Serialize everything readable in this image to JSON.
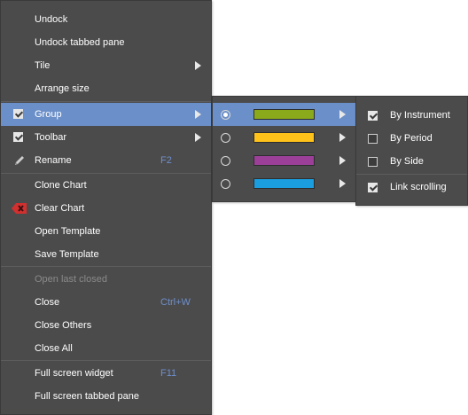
{
  "main_menu": {
    "items": [
      {
        "label": "Undock"
      },
      {
        "label": "Undock tabbed pane"
      },
      {
        "label": "Tile"
      },
      {
        "label": "Arrange size"
      },
      {
        "label": "Group"
      },
      {
        "label": "Toolbar"
      },
      {
        "label": "Rename",
        "shortcut": "F2"
      },
      {
        "label": "Clone Chart"
      },
      {
        "label": "Clear Chart"
      },
      {
        "label": "Open Template"
      },
      {
        "label": "Save Template"
      },
      {
        "label": "Open last closed"
      },
      {
        "label": "Close",
        "shortcut": "Ctrl+W"
      },
      {
        "label": "Close Others"
      },
      {
        "label": "Close All"
      },
      {
        "label": "Full screen widget",
        "shortcut": "F11"
      },
      {
        "label": "Full screen tabbed pane"
      }
    ]
  },
  "color_groups": [
    {
      "color": "#8aaa1c",
      "selected": true
    },
    {
      "color": "#ffc21a",
      "selected": false
    },
    {
      "color": "#9b3f99",
      "selected": false
    },
    {
      "color": "#1a9ee0",
      "selected": false
    }
  ],
  "group_submenu": {
    "items": [
      {
        "label": "By Instrument",
        "checked": true
      },
      {
        "label": "By Period",
        "checked": false
      },
      {
        "label": "By Side",
        "checked": false
      },
      {
        "label": "Link scrolling",
        "checked": true
      }
    ]
  },
  "colors": {
    "menu_bg": "#4b4b4b",
    "highlight": "#6b8fc9",
    "shortcut": "#6f8fcc",
    "disabled": "#8a8a8a"
  }
}
